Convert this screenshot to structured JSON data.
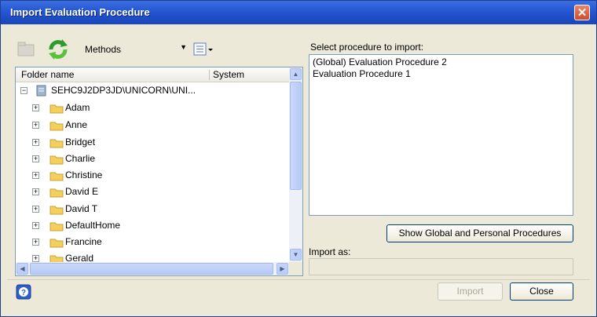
{
  "window": {
    "title": "Import Evaluation Procedure",
    "close_glyph": "✕"
  },
  "toolbar": {
    "methods_value": "Methods",
    "dropdown_glyph": "▼"
  },
  "tree": {
    "col_folder": "Folder name",
    "col_system": "System",
    "root": "SEHC9J2DP3JD\\UNICORN\\UNI...",
    "folders": [
      "Adam",
      "Anne",
      "Bridget",
      "Charlie",
      "Christine",
      "David E",
      "David T",
      "DefaultHome",
      "Francine",
      "Gerald"
    ]
  },
  "right": {
    "select_label": "Select procedure to import:",
    "procedures": [
      "(Global) Evaluation Procedure 2",
      "Evaluation Procedure 1"
    ],
    "show_button": "Show Global and Personal Procedures",
    "import_as_label": "Import as:",
    "import_as_value": ""
  },
  "footer": {
    "import_button": "Import",
    "close_button": "Close"
  },
  "colors": {
    "title_bar": "#2a5bd7",
    "folder": "#f5cf5b",
    "window_bg": "#ece9d8"
  }
}
